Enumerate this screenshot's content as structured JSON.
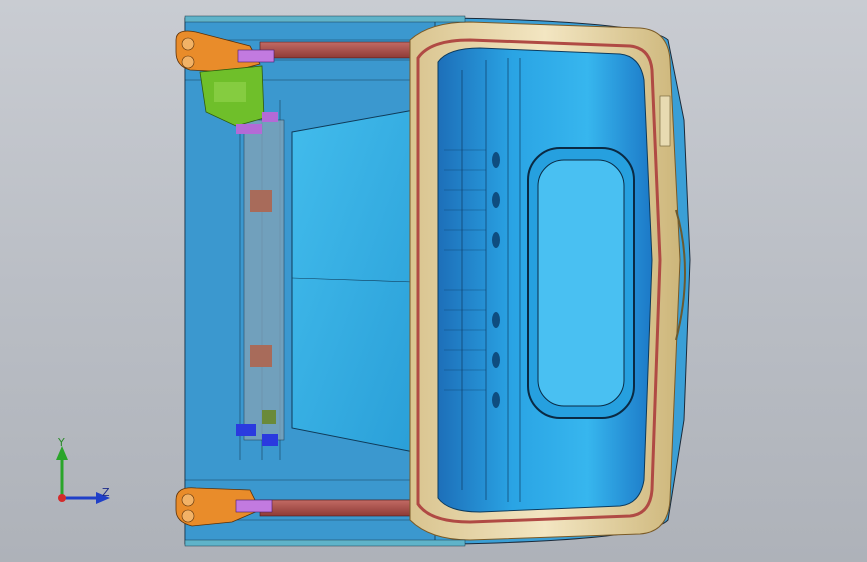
{
  "viewport": {
    "background_top": "#c9ccd2",
    "background_bottom": "#aeb2b9"
  },
  "model": {
    "description_colors": {
      "panel_blue": "#2ea8e6",
      "panel_blue_dark": "#1f7fc4",
      "frame_tan": "#e6d3a3",
      "frame_red": "#b04a44",
      "bracket_orange": "#e98c2a",
      "bracket_green": "#6fbf2a",
      "bracket_purple": "#b46ad6",
      "flat_panel": "#34b2e6"
    }
  },
  "triad": {
    "y_label": "Y",
    "z_label": "Z",
    "y_color": "#2aa52a",
    "z_color": "#1f3fc8",
    "origin_color": "#d42a2a"
  }
}
